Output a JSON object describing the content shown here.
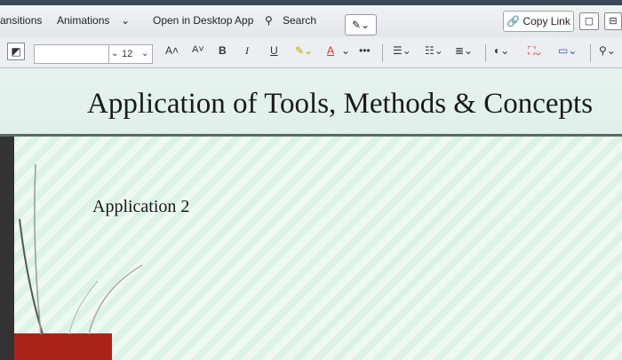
{
  "ribbon": {
    "tabs": [
      "ansitions",
      "Animations",
      "Open in Desktop App",
      "Search"
    ],
    "copy_link_label": "Copy Link"
  },
  "toolbar": {
    "font_size": "12",
    "bold": "B",
    "italic": "I",
    "underline": "U",
    "more": "•••"
  },
  "slide": {
    "title": "Application of Tools, Methods & Concepts",
    "subtitle": "Application 2"
  },
  "colors": {
    "title_rule": "#5a6b67",
    "accent_red": "#a82418",
    "font_color_underline": "#d9342b",
    "highlight_yellow": "#f2c200"
  }
}
